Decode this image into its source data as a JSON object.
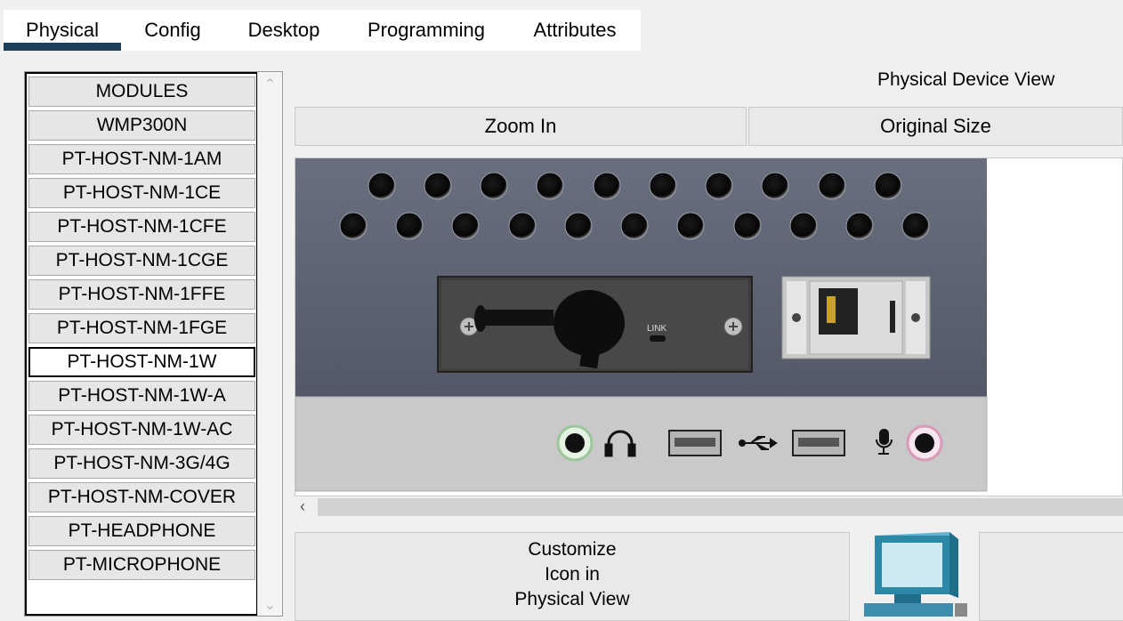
{
  "tabs": [
    {
      "label": "Physical",
      "active": true
    },
    {
      "label": "Config"
    },
    {
      "label": "Desktop"
    },
    {
      "label": "Programming"
    },
    {
      "label": "Attributes"
    }
  ],
  "modules": {
    "items": [
      "MODULES",
      "WMP300N",
      "PT-HOST-NM-1AM",
      "PT-HOST-NM-1CE",
      "PT-HOST-NM-1CFE",
      "PT-HOST-NM-1CGE",
      "PT-HOST-NM-1FFE",
      "PT-HOST-NM-1FGE",
      "PT-HOST-NM-1W",
      "PT-HOST-NM-1W-A",
      "PT-HOST-NM-1W-AC",
      "PT-HOST-NM-3G/4G",
      "PT-HOST-NM-COVER",
      "PT-HEADPHONE",
      "PT-MICROPHONE"
    ],
    "selected": "PT-HOST-NM-1W"
  },
  "physical_view": {
    "title": "Physical Device View",
    "zoom_in": "Zoom In",
    "original_size": "Original Size",
    "link_label": "LINK"
  },
  "customize": {
    "line1": "Customize",
    "line2": "Icon in",
    "line3": "Physical View"
  },
  "icons": {
    "device": "pc-monitor-icon",
    "headphone": "headphone-icon",
    "usb": "usb-icon",
    "microphone": "microphone-icon"
  },
  "colors": {
    "active_tab_underline": "#1e3f5a",
    "device_panel": "#5a6070",
    "device_bottom": "#c9c9c9"
  }
}
